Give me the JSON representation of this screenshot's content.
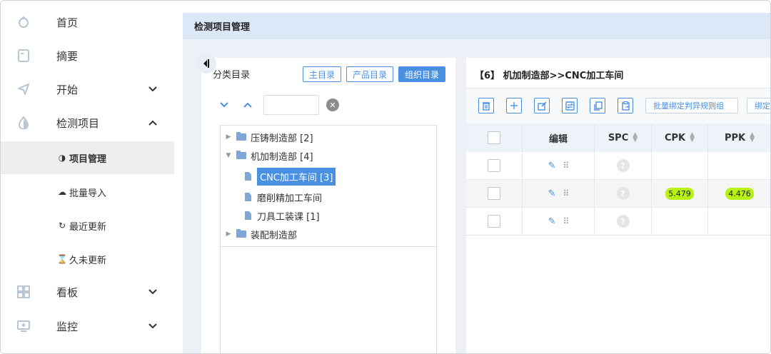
{
  "sidebar": {
    "items": [
      {
        "label": "首页",
        "icon": "home-icon"
      },
      {
        "label": "摘要",
        "icon": "document-icon"
      },
      {
        "label": "开始",
        "icon": "send-icon"
      },
      {
        "label": "检测项目",
        "icon": "drop-icon"
      },
      {
        "label": "看板",
        "icon": "dashboard-icon"
      },
      {
        "label": "监控",
        "icon": "monitor-icon"
      }
    ],
    "sub_items": [
      {
        "label": "项目管理",
        "icon": "◑"
      },
      {
        "label": "批量导入",
        "icon": "☁"
      },
      {
        "label": "最近更新",
        "icon": "↻"
      },
      {
        "label": "久未更新",
        "icon": "⌛"
      }
    ]
  },
  "main": {
    "header_title": "检测项目管理"
  },
  "category": {
    "title": "分类目录",
    "buttons": [
      "主目录",
      "产品目录",
      "组织目录"
    ],
    "search_value": "",
    "tree": [
      {
        "label": "压铸制造部 [2]"
      },
      {
        "label": "机加制造部 [4]"
      },
      {
        "label": "CNC加工车间 [3]"
      },
      {
        "label": "磨削精加工车间"
      },
      {
        "label": "刀具工装课 [1]"
      },
      {
        "label": "装配制造部"
      }
    ]
  },
  "detail": {
    "title": "【6】 机加制造部>>CNC加工车间",
    "toolbar": {
      "batch_bind_label": "批量绑定判异规则组",
      "bind_label": "绑定"
    },
    "columns": [
      "编辑",
      "SPC",
      "CPK",
      "PPK"
    ],
    "rows": [
      {
        "cpk": "",
        "ppk": ""
      },
      {
        "cpk": "5.479",
        "ppk": "4.476"
      },
      {
        "cpk": "",
        "ppk": ""
      }
    ]
  },
  "colors": {
    "accent": "#4a90e2",
    "header_bg": "#dce8f8",
    "highlight": "#b7f215"
  }
}
